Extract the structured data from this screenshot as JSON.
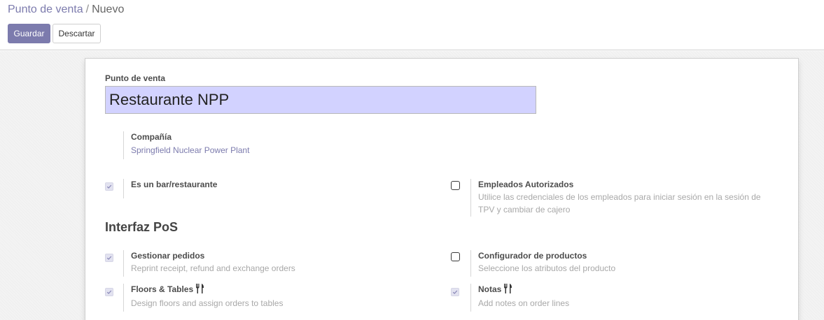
{
  "breadcrumb": {
    "parent": "Punto de venta",
    "separator": "/",
    "current": "Nuevo"
  },
  "toolbar": {
    "save_label": "Guardar",
    "discard_label": "Descartar"
  },
  "form": {
    "name_label": "Punto de venta",
    "name_value": "Restaurante NPP",
    "company": {
      "label": "Compañía",
      "value": "Springfield Nuclear Power Plant"
    },
    "is_restaurant": {
      "label": "Es un bar/restaurante",
      "checked": true
    },
    "authorized_employees": {
      "label": "Empleados Autorizados",
      "help": "Utilice las credenciales de los empleados para iniciar sesión en la sesión de TPV y cambiar de cajero",
      "checked": false
    },
    "section_title": "Interfaz PoS",
    "manage_orders": {
      "label": "Gestionar pedidos",
      "help": "Reprint receipt, refund and exchange orders",
      "checked": true
    },
    "product_configurator": {
      "label": "Configurador de productos",
      "help": "Seleccione los atributos del producto",
      "checked": false
    },
    "floors_tables": {
      "label": "Floors & Tables",
      "help": "Design floors and assign orders to tables",
      "checked": true,
      "icon": "utensils-icon"
    },
    "notes": {
      "label": "Notas",
      "help": "Add notes on order lines",
      "checked": true,
      "icon": "utensils-icon"
    }
  },
  "colors": {
    "brand": "#7c7bad",
    "input_highlight": "#d2d2ff",
    "help_text": "#a8a8a8"
  }
}
